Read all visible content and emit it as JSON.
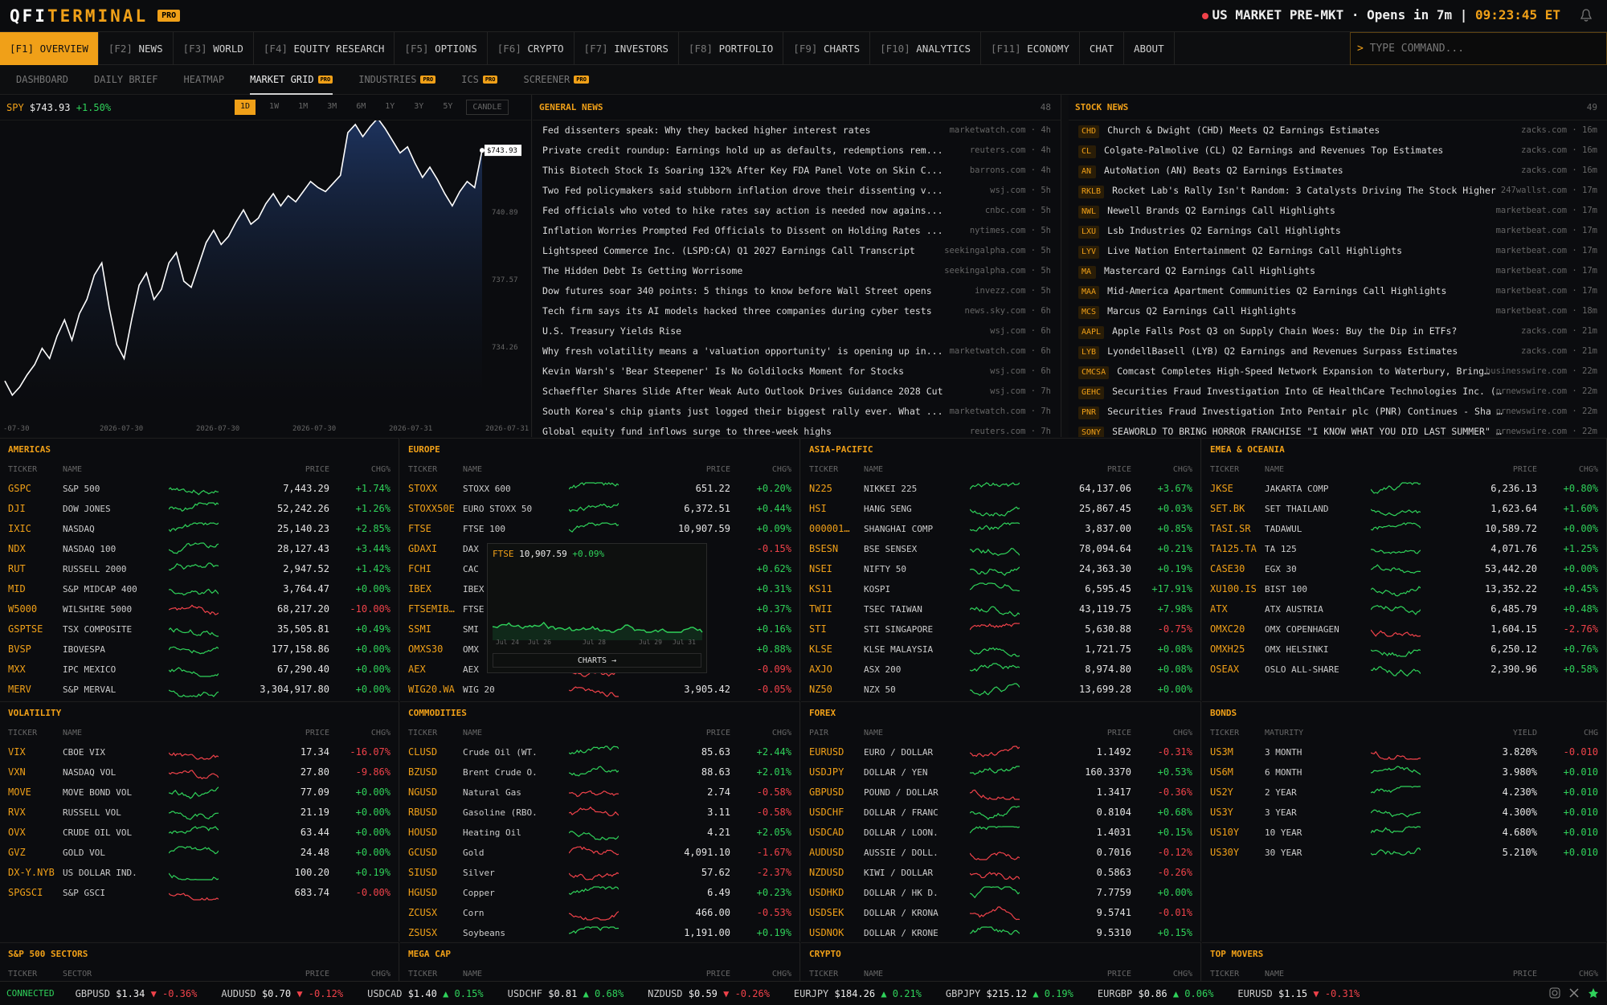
{
  "app": {
    "logo1": "QFI",
    "logo2": "TERMINAL",
    "pro": "PRO",
    "market": "US MARKET PRE-MKT · Opens in 7m",
    "sep": "|",
    "time": "09:23:45 ET",
    "command_placeholder": "TYPE COMMAND...",
    "command_prompt": ">"
  },
  "nav": [
    {
      "key": "[F1]",
      "label": "OVERVIEW"
    },
    {
      "key": "[F2]",
      "label": "NEWS"
    },
    {
      "key": "[F3]",
      "label": "WORLD"
    },
    {
      "key": "[F4]",
      "label": "EQUITY RESEARCH"
    },
    {
      "key": "[F5]",
      "label": "OPTIONS"
    },
    {
      "key": "[F6]",
      "label": "CRYPTO"
    },
    {
      "key": "[F7]",
      "label": "INVESTORS"
    },
    {
      "key": "[F8]",
      "label": "PORTFOLIO"
    },
    {
      "key": "[F9]",
      "label": "CHARTS"
    },
    {
      "key": "[F10]",
      "label": "ANALYTICS"
    },
    {
      "key": "[F11]",
      "label": "ECONOMY"
    },
    {
      "key": "",
      "label": "CHAT"
    },
    {
      "key": "",
      "label": "ABOUT"
    }
  ],
  "subnav": [
    {
      "label": "DASHBOARD",
      "pro": ""
    },
    {
      "label": "DAILY BRIEF",
      "pro": ""
    },
    {
      "label": "HEATMAP",
      "pro": ""
    },
    {
      "label": "MARKET GRID",
      "pro": "PRO"
    },
    {
      "label": "INDUSTRIES",
      "pro": "PRO"
    },
    {
      "label": "ICS",
      "pro": "PRO"
    },
    {
      "label": "SCREENER",
      "pro": "PRO"
    }
  ],
  "chart": {
    "symbol": "SPY",
    "price": "$743.93",
    "change": "+1.50%",
    "ranges": [
      "1D",
      "1W",
      "1M",
      "3M",
      "6M",
      "1Y",
      "3Y",
      "5Y"
    ],
    "candle": "CANDLE",
    "last_label": "$743.93",
    "yticks": [
      "740.89",
      "737.57",
      "734.26"
    ],
    "xticks": [
      "-07-30",
      "2026-07-30",
      "2026-07-30",
      "2026-07-30",
      "2026-07-31",
      "2026-07-31"
    ]
  },
  "chart_data": {
    "type": "line",
    "title": "SPY",
    "ylabel": "",
    "xlabel": "",
    "ylim": [
      731.5,
      745
    ],
    "values": [
      732.6,
      731.9,
      732.3,
      732.9,
      733.4,
      734.2,
      733.7,
      734.8,
      735.6,
      734.6,
      735.9,
      736.6,
      737.8,
      738.4,
      736.2,
      734.4,
      733.7,
      735.6,
      737.3,
      737.9,
      736.6,
      737.1,
      738.4,
      738.9,
      737.5,
      737.2,
      738.3,
      739.4,
      740.0,
      739.3,
      739.7,
      740.4,
      741.0,
      740.3,
      740.6,
      741.3,
      741.8,
      741.2,
      741.7,
      741.4,
      741.9,
      742.4,
      742.1,
      741.9,
      742.3,
      742.7,
      744.8,
      745.2,
      744.6,
      745.1,
      745.5,
      745.0,
      744.4,
      743.8,
      744.1,
      743.3,
      742.6,
      743.1,
      742.5,
      741.8,
      741.2,
      741.9,
      742.4,
      742.1,
      743.93
    ]
  },
  "general_news": {
    "title": "GENERAL NEWS",
    "count": "48",
    "items": [
      {
        "t": "Fed dissenters speak: Why they backed higher interest rates",
        "s": "marketwatch.com · 4h"
      },
      {
        "t": "Private credit roundup: Earnings hold up as defaults, redemptions rem...",
        "s": "reuters.com · 4h"
      },
      {
        "t": "This Biotech Stock Is Soaring 132% After Key FDA Panel Vote on Skin C...",
        "s": "barrons.com · 4h"
      },
      {
        "t": "Two Fed policymakers said stubborn inflation drove their dissenting v...",
        "s": "wsj.com · 5h"
      },
      {
        "t": "Fed officials who voted to hike rates say action is needed now agains...",
        "s": "cnbc.com · 5h"
      },
      {
        "t": "Inflation Worries Prompted Fed Officials to Dissent on Holding Rates ...",
        "s": "nytimes.com · 5h"
      },
      {
        "t": "Lightspeed Commerce Inc. (LSPD:CA) Q1 2027 Earnings Call Transcript",
        "s": "seekingalpha.com · 5h"
      },
      {
        "t": "The Hidden Debt Is Getting Worrisome",
        "s": "seekingalpha.com · 5h"
      },
      {
        "t": "Dow futures soar 340 points: 5 things to know before Wall Street opens",
        "s": "invezz.com · 5h"
      },
      {
        "t": "Tech firm says its AI models hacked three companies during cyber tests",
        "s": "news.sky.com · 6h"
      },
      {
        "t": "U.S. Treasury Yields Rise",
        "s": "wsj.com · 6h"
      },
      {
        "t": "Why fresh volatility means a 'valuation opportunity' is opening up in...",
        "s": "marketwatch.com · 6h"
      },
      {
        "t": "Kevin Warsh's 'Bear Steepener' Is No Goldilocks Moment for Stocks",
        "s": "wsj.com · 6h"
      },
      {
        "t": "Schaeffler Shares Slide After Weak Auto Outlook Drives Guidance 2028 Cut",
        "s": "wsj.com · 7h"
      },
      {
        "t": "South Korea's chip giants just logged their biggest rally ever. What ...",
        "s": "marketwatch.com · 7h"
      },
      {
        "t": "Global equity fund inflows surge to three-week highs",
        "s": "reuters.com · 7h"
      }
    ]
  },
  "stock_news": {
    "title": "STOCK NEWS",
    "count": "49",
    "items": [
      {
        "k": "CHD",
        "t": "Church & Dwight (CHD) Meets Q2 Earnings Estimates",
        "s": "zacks.com · 16m"
      },
      {
        "k": "CL",
        "t": "Colgate-Palmolive (CL) Q2 Earnings and Revenues Top Estimates",
        "s": "zacks.com · 16m"
      },
      {
        "k": "AN",
        "t": "AutoNation (AN) Beats Q2 Earnings Estimates",
        "s": "zacks.com · 16m"
      },
      {
        "k": "RKLB",
        "t": "Rocket Lab's Rally Isn't Random: 3 Catalysts Driving The Stock Higher",
        "s": "247wallst.com · 17m"
      },
      {
        "k": "NWL",
        "t": "Newell Brands Q2 Earnings Call Highlights",
        "s": "marketbeat.com · 17m"
      },
      {
        "k": "LXU",
        "t": "Lsb Industries Q2 Earnings Call Highlights",
        "s": "marketbeat.com · 17m"
      },
      {
        "k": "LYV",
        "t": "Live Nation Entertainment Q2 Earnings Call Highlights",
        "s": "marketbeat.com · 17m"
      },
      {
        "k": "MA",
        "t": "Mastercard Q2 Earnings Call Highlights",
        "s": "marketbeat.com · 17m"
      },
      {
        "k": "MAA",
        "t": "Mid-America Apartment Communities Q2 Earnings Call Highlights",
        "s": "marketbeat.com · 17m"
      },
      {
        "k": "MCS",
        "t": "Marcus Q2 Earnings Call Highlights",
        "s": "marketbeat.com · 18m"
      },
      {
        "k": "AAPL",
        "t": "Apple Falls Post Q3 on Supply Chain Woes: Buy the Dip in ETFs?",
        "s": "zacks.com · 21m"
      },
      {
        "k": "LYB",
        "t": "LyondellBasell (LYB) Q2 Earnings and Revenues Surpass Estimates",
        "s": "zacks.com · 21m"
      },
      {
        "k": "CMCSA",
        "t": "Comcast Completes High-Speed Network Expansion to Waterbury, Bring…",
        "s": "businesswire.com · 22m"
      },
      {
        "k": "GEHC",
        "t": "Securities Fraud Investigation Into GE HealthCare Technologies Inc. (…",
        "s": "prnewswire.com · 22m"
      },
      {
        "k": "PNR",
        "t": "Securities Fraud Investigation Into Pentair plc (PNR) Continues - Sha …",
        "s": "prnewswire.com · 22m"
      },
      {
        "k": "SONY",
        "t": "SEAWORLD TO BRING HORROR FRANCHISE \"I KNOW WHAT YOU DID LAST SUMMER\" …",
        "s": "prnewswire.com · 22m"
      }
    ]
  },
  "cols": {
    "ticker": "TICKER",
    "name": "NAME",
    "price": "PRICE",
    "chg": "CHG%",
    "pair": "PAIR",
    "maturity": "MATURITY",
    "yield": "YIELD",
    "chg2": "CHG",
    "sector": "SECTOR"
  },
  "panels": [
    {
      "title": "AMERICAS",
      "rows": [
        [
          "GSPC",
          "S&P 500",
          "7,443.29",
          "+1.74%"
        ],
        [
          "DJI",
          "DOW JONES",
          "52,242.26",
          "+1.26%"
        ],
        [
          "IXIC",
          "NASDAQ",
          "25,140.23",
          "+2.85%"
        ],
        [
          "NDX",
          "NASDAQ 100",
          "28,127.43",
          "+3.44%"
        ],
        [
          "RUT",
          "RUSSELL 2000",
          "2,947.52",
          "+1.42%"
        ],
        [
          "MID",
          "S&P MIDCAP 400",
          "3,764.47",
          "+0.00%"
        ],
        [
          "W5000",
          "WILSHIRE 5000",
          "68,217.20",
          "-10.00%"
        ],
        [
          "GSPTSE",
          "TSX COMPOSITE",
          "35,505.81",
          "+0.49%"
        ],
        [
          "BVSP",
          "IBOVESPA",
          "177,158.86",
          "+0.00%"
        ],
        [
          "MXX",
          "IPC MEXICO",
          "67,290.40",
          "+0.00%"
        ],
        [
          "MERV",
          "S&P MERVAL",
          "3,304,917.80",
          "+0.00%"
        ]
      ]
    },
    {
      "title": "EUROPE",
      "rows": [
        [
          "STOXX",
          "STOXX 600",
          "651.22",
          "+0.20%"
        ],
        [
          "STOXX50E",
          "EURO STOXX 50",
          "6,372.51",
          "+0.44%"
        ],
        [
          "FTSE",
          "FTSE 100",
          "10,907.59",
          "+0.09%"
        ],
        [
          "GDAXI",
          "DAX",
          "",
          "-0.15%"
        ],
        [
          "FCHI",
          "CAC",
          "",
          "+0.62%"
        ],
        [
          "IBEX",
          "IBEX",
          "",
          "+0.31%"
        ],
        [
          "FTSEMIB…",
          "FTSE",
          "",
          "+0.37%"
        ],
        [
          "SSMI",
          "SMI",
          "",
          "+0.16%"
        ],
        [
          "OMXS30",
          "OMX",
          "",
          "+0.88%"
        ],
        [
          "AEX",
          "AEX",
          "",
          "-0.09%"
        ],
        [
          "WIG20.WA",
          "WIG 20",
          "3,905.42",
          "-0.05%"
        ]
      ]
    },
    {
      "title": "ASIA-PACIFIC",
      "rows": [
        [
          "N225",
          "NIKKEI 225",
          "64,137.06",
          "+3.67%"
        ],
        [
          "HSI",
          "HANG SENG",
          "25,867.45",
          "+0.03%"
        ],
        [
          "000001…",
          "SHANGHAI COMP",
          "3,837.00",
          "+0.85%"
        ],
        [
          "BSESN",
          "BSE SENSEX",
          "78,094.64",
          "+0.21%"
        ],
        [
          "NSEI",
          "NIFTY 50",
          "24,363.30",
          "+0.19%"
        ],
        [
          "KS11",
          "KOSPI",
          "6,595.45",
          "+17.91%"
        ],
        [
          "TWII",
          "TSEC TAIWAN",
          "43,119.75",
          "+7.98%"
        ],
        [
          "STI",
          "STI SINGAPORE",
          "5,630.88",
          "-0.75%"
        ],
        [
          "KLSE",
          "KLSE MALAYSIA",
          "1,721.75",
          "+0.08%"
        ],
        [
          "AXJO",
          "ASX 200",
          "8,974.80",
          "+0.08%"
        ],
        [
          "NZ50",
          "NZX 50",
          "13,699.28",
          "+0.00%"
        ]
      ]
    },
    {
      "title": "EMEA & OCEANIA",
      "rows": [
        [
          "JKSE",
          "JAKARTA COMP",
          "6,236.13",
          "+0.80%"
        ],
        [
          "SET.BK",
          "SET THAILAND",
          "1,623.64",
          "+1.60%"
        ],
        [
          "TASI.SR",
          "TADAWUL",
          "10,589.72",
          "+0.00%"
        ],
        [
          "TA125.TA",
          "TA 125",
          "4,071.76",
          "+1.25%"
        ],
        [
          "CASE30",
          "EGX 30",
          "53,442.20",
          "+0.00%"
        ],
        [
          "XU100.IS",
          "BIST 100",
          "13,352.22",
          "+0.45%"
        ],
        [
          "ATX",
          "ATX AUSTRIA",
          "6,485.79",
          "+0.48%"
        ],
        [
          "OMXC20",
          "OMX COPENHAGEN",
          "1,604.15",
          "-2.76%"
        ],
        [
          "OMXH25",
          "OMX HELSINKI",
          "6,250.12",
          "+0.76%"
        ],
        [
          "OSEAX",
          "OSLO ALL-SHARE",
          "2,390.96",
          "+0.58%"
        ]
      ]
    },
    {
      "title": "VOLATILITY",
      "rows": [
        [
          "VIX",
          "CBOE VIX",
          "17.34",
          "-16.07%"
        ],
        [
          "VXN",
          "NASDAQ VOL",
          "27.80",
          "-9.86%"
        ],
        [
          "MOVE",
          "MOVE BOND VOL",
          "77.09",
          "+0.00%"
        ],
        [
          "RVX",
          "RUSSELL VOL",
          "21.19",
          "+0.00%"
        ],
        [
          "OVX",
          "CRUDE OIL VOL",
          "63.44",
          "+0.00%"
        ],
        [
          "GVZ",
          "GOLD VOL",
          "24.48",
          "+0.00%"
        ],
        [
          "DX-Y.NYB",
          "US DOLLAR IND.",
          "100.20",
          "+0.19%"
        ],
        [
          "SPGSCI",
          "S&P GSCI",
          "683.74",
          "-0.00%"
        ]
      ]
    },
    {
      "title": "COMMODITIES",
      "rows": [
        [
          "CLUSD",
          "Crude Oil (WT.",
          "85.63",
          "+2.44%"
        ],
        [
          "BZUSD",
          "Brent Crude O.",
          "88.63",
          "+2.01%"
        ],
        [
          "NGUSD",
          "Natural Gas",
          "2.74",
          "-0.58%"
        ],
        [
          "RBUSD",
          "Gasoline (RBO.",
          "3.11",
          "-0.58%"
        ],
        [
          "HOUSD",
          "Heating Oil",
          "4.21",
          "+2.05%"
        ],
        [
          "GCUSD",
          "Gold",
          "4,091.10",
          "-1.67%"
        ],
        [
          "SIUSD",
          "Silver",
          "57.62",
          "-2.37%"
        ],
        [
          "HGUSD",
          "Copper",
          "6.49",
          "+0.23%"
        ],
        [
          "ZCUSX",
          "Corn",
          "466.00",
          "-0.53%"
        ],
        [
          "ZSUSX",
          "Soybeans",
          "1,191.00",
          "+0.19%"
        ]
      ]
    },
    {
      "title": "FOREX",
      "rows": [
        [
          "EURUSD",
          "EURO / DOLLAR",
          "1.1492",
          "-0.31%"
        ],
        [
          "USDJPY",
          "DOLLAR / YEN",
          "160.3370",
          "+0.53%"
        ],
        [
          "GBPUSD",
          "POUND / DOLLAR",
          "1.3417",
          "-0.36%"
        ],
        [
          "USDCHF",
          "DOLLAR / FRANC",
          "0.8104",
          "+0.68%"
        ],
        [
          "USDCAD",
          "DOLLAR / LOON.",
          "1.4031",
          "+0.15%"
        ],
        [
          "AUDUSD",
          "AUSSIE / DOLL.",
          "0.7016",
          "-0.12%"
        ],
        [
          "NZDUSD",
          "KIWI / DOLLAR",
          "0.5863",
          "-0.26%"
        ],
        [
          "USDHKD",
          "DOLLAR / HK D.",
          "7.7759",
          "+0.00%"
        ],
        [
          "USDSEK",
          "DOLLAR / KRONA",
          "9.5741",
          "-0.01%"
        ],
        [
          "USDNOK",
          "DOLLAR / KRONE",
          "9.5310",
          "+0.15%"
        ]
      ]
    },
    {
      "title": "BONDS",
      "rows": [
        [
          "US3M",
          "3 MONTH",
          "3.820%",
          "-0.010"
        ],
        [
          "US6M",
          "6 MONTH",
          "3.980%",
          "+0.010"
        ],
        [
          "US2Y",
          "2 YEAR",
          "4.230%",
          "+0.010"
        ],
        [
          "US3Y",
          "3 YEAR",
          "4.300%",
          "+0.010"
        ],
        [
          "US10Y",
          "10 YEAR",
          "4.680%",
          "+0.010"
        ],
        [
          "US30Y",
          "30 YEAR",
          "5.210%",
          "+0.010"
        ]
      ]
    }
  ],
  "bottom_panels": [
    "S&P 500 SECTORS",
    "MEGA CAP",
    "CRYPTO",
    "TOP MOVERS"
  ],
  "popup": {
    "ticker": "FTSE",
    "price": "10,907.59",
    "change": "+0.09%",
    "dates": [
      "Jul 24",
      "Jul 26",
      "Jul 28",
      "Jul 29",
      "Jul 31"
    ],
    "button": "CHARTS →"
  },
  "ticker_bar": {
    "status": "CONNECTED",
    "items": [
      {
        "s": "GBPUSD",
        "p": "$1.34",
        "c": "▼ -0.36%",
        "up": false
      },
      {
        "s": "AUDUSD",
        "p": "$0.70",
        "c": "▼ -0.12%",
        "up": false
      },
      {
        "s": "USDCAD",
        "p": "$1.40",
        "c": "▲ 0.15%",
        "up": true
      },
      {
        "s": "USDCHF",
        "p": "$0.81",
        "c": "▲ 0.68%",
        "up": true
      },
      {
        "s": "NZDUSD",
        "p": "$0.59",
        "c": "▼ -0.26%",
        "up": false
      },
      {
        "s": "EURJPY",
        "p": "$184.26",
        "c": "▲ 0.21%",
        "up": true
      },
      {
        "s": "GBPJPY",
        "p": "$215.12",
        "c": "▲ 0.19%",
        "up": true
      },
      {
        "s": "EURGBP",
        "p": "$0.86",
        "c": "▲ 0.06%",
        "up": true
      },
      {
        "s": "EURUSD",
        "p": "$1.15",
        "c": "▼ -0.31%",
        "up": false
      }
    ]
  },
  "colors": {
    "accent": "#f0a018",
    "up": "#2fd25a",
    "down": "#f0424a"
  }
}
